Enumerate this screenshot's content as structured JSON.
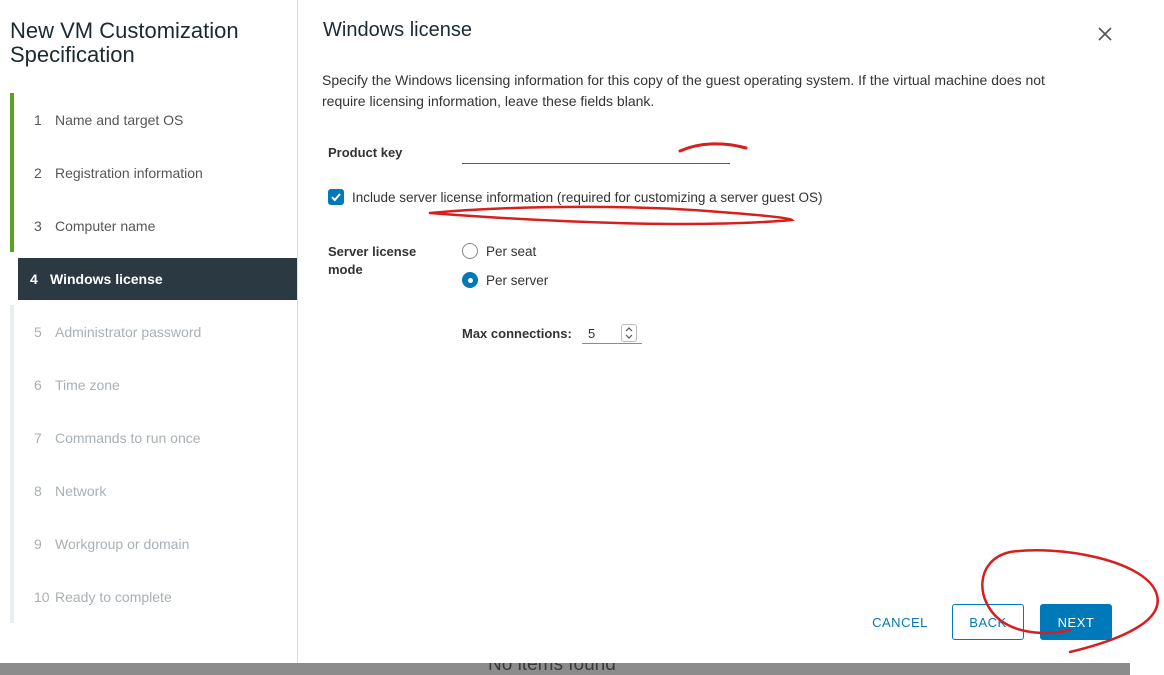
{
  "backdrop": {
    "text": "No items found"
  },
  "wizard": {
    "title": "New VM Customization Specification",
    "steps": [
      {
        "num": "1",
        "label": "Name and target OS"
      },
      {
        "num": "2",
        "label": "Registration information"
      },
      {
        "num": "3",
        "label": "Computer name"
      },
      {
        "num": "4",
        "label": "Windows license"
      },
      {
        "num": "5",
        "label": "Administrator password"
      },
      {
        "num": "6",
        "label": "Time zone"
      },
      {
        "num": "7",
        "label": "Commands to run once"
      },
      {
        "num": "8",
        "label": "Network"
      },
      {
        "num": "9",
        "label": "Workgroup or domain"
      },
      {
        "num": "10",
        "label": "Ready to complete"
      }
    ]
  },
  "page": {
    "title": "Windows license",
    "description": "Specify the Windows licensing information for this copy of the guest operating system. If the virtual machine does not require licensing information, leave these fields blank.",
    "product_key_label": "Product key",
    "product_key_value": "",
    "include_server_license": "Include server license information (required for customizing a server guest OS)",
    "server_license_mode_label": "Server license mode",
    "radio_per_seat": "Per seat",
    "radio_per_server": "Per server",
    "max_connections_label": "Max connections:",
    "max_connections_value": "5"
  },
  "buttons": {
    "cancel": "CANCEL",
    "back": "BACK",
    "next": "NEXT"
  },
  "colors": {
    "accent": "#0079b8",
    "done_step": "#5aa220",
    "current_step_bg": "#2b3a42",
    "annotation": "#d61f1f"
  }
}
